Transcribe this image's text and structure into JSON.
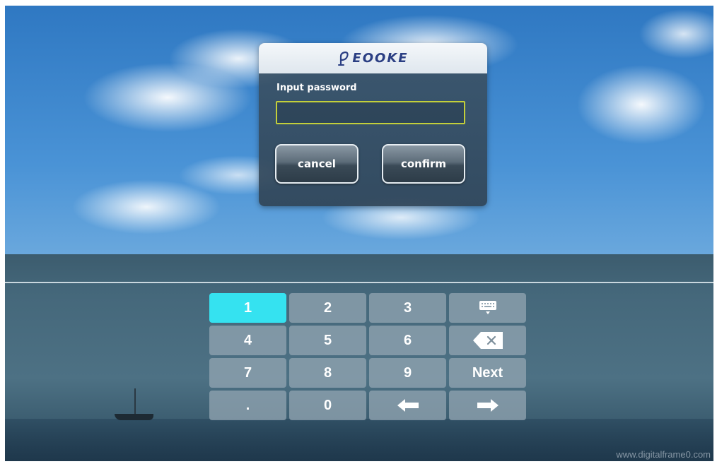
{
  "dialog": {
    "brand": "EOOKE",
    "label": "Input password",
    "password_value": "",
    "cancel_label": "cancel",
    "confirm_label": "confirm",
    "input_border_color": "#c3cf3a"
  },
  "keypad": {
    "keys": [
      {
        "label": "1",
        "active": true
      },
      {
        "label": "2"
      },
      {
        "label": "3"
      },
      {
        "icon": "keyboard-icon"
      },
      {
        "label": "4"
      },
      {
        "label": "5"
      },
      {
        "label": "6"
      },
      {
        "icon": "backspace-icon"
      },
      {
        "label": "7"
      },
      {
        "label": "8"
      },
      {
        "label": "9"
      },
      {
        "label": "Next"
      },
      {
        "label": "."
      },
      {
        "label": "0"
      },
      {
        "icon": "arrow-left-icon"
      },
      {
        "icon": "arrow-right-icon"
      }
    ],
    "active_color": "#35e2f0"
  },
  "watermark": "www.digitalframe0.com"
}
